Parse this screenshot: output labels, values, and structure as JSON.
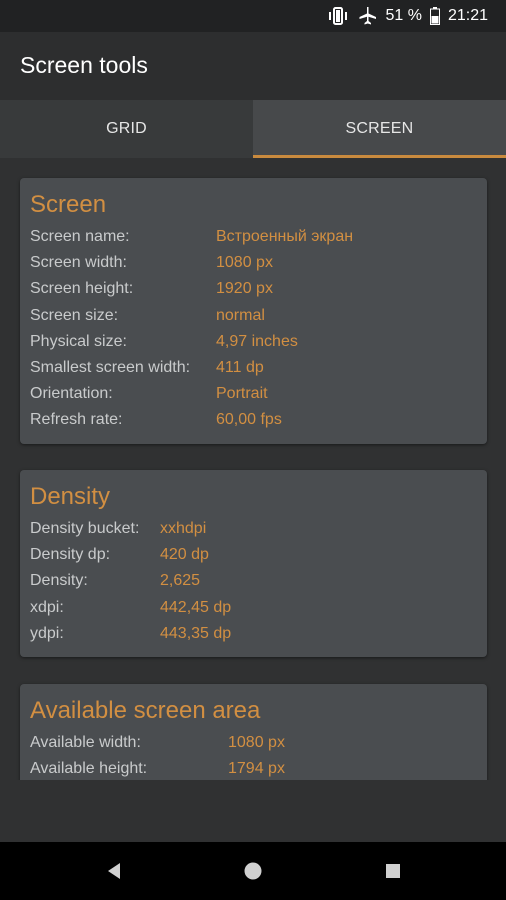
{
  "status_bar": {
    "battery_percent": "51 %",
    "time": "21:21",
    "icons": [
      "vibrate-icon",
      "airplane-mode-icon",
      "battery-icon"
    ]
  },
  "app_bar": {
    "title": "Screen tools"
  },
  "tabs": [
    {
      "label": "GRID",
      "active": false
    },
    {
      "label": "SCREEN",
      "active": true
    }
  ],
  "cards": {
    "screen": {
      "title": "Screen",
      "rows": [
        {
          "label": "Screen name:",
          "value": "Встроенный экран"
        },
        {
          "label": "Screen width:",
          "value": "1080 px"
        },
        {
          "label": "Screen height:",
          "value": "1920 px"
        },
        {
          "label": "Screen size:",
          "value": "normal"
        },
        {
          "label": "Physical size:",
          "value": "4,97 inches"
        },
        {
          "label": "Smallest screen width:",
          "value": "411 dp"
        },
        {
          "label": "Orientation:",
          "value": "Portrait"
        },
        {
          "label": "Refresh rate:",
          "value": "60,00 fps"
        }
      ]
    },
    "density": {
      "title": "Density",
      "rows": [
        {
          "label": "Density bucket:",
          "value": "xxhdpi"
        },
        {
          "label": "Density dp:",
          "value": "420 dp"
        },
        {
          "label": "Density:",
          "value": "2,625"
        },
        {
          "label": "xdpi:",
          "value": "442,45 dp"
        },
        {
          "label": "ydpi:",
          "value": "443,35 dp"
        }
      ]
    },
    "available": {
      "title": "Available screen area",
      "rows": [
        {
          "label": "Available width:",
          "value": "1080 px"
        },
        {
          "label": "Available height:",
          "value": "1794 px"
        }
      ]
    }
  },
  "nav_bar": {
    "icons": [
      "back-icon",
      "home-icon",
      "recents-icon"
    ]
  },
  "colors": {
    "accent": "#d28f42",
    "tab_indicator": "#c98a3e",
    "card_bg": "#4a4d50",
    "page_bg": "#303132"
  }
}
